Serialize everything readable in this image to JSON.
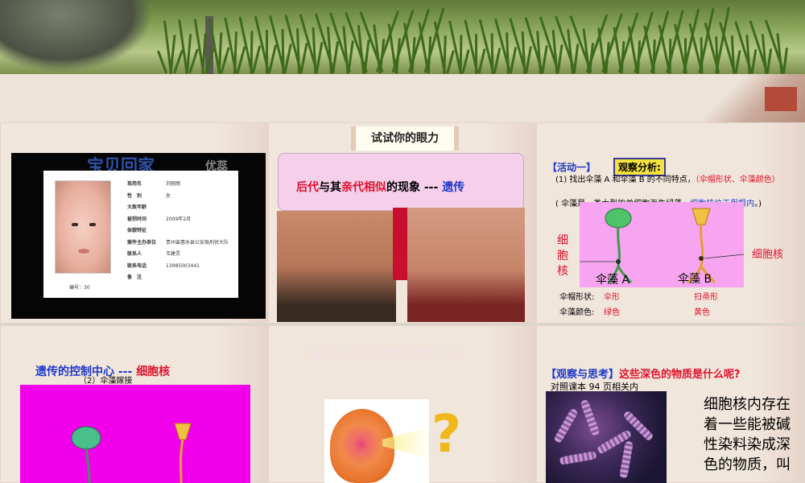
{
  "slide1": {
    "title": "宝贝回家",
    "subtitle": "优蕊",
    "fields": [
      {
        "k": "现用名",
        "v": "刘丽丽"
      },
      {
        "k": "性　别",
        "v": "女"
      },
      {
        "k": "大致年龄",
        "v": ""
      },
      {
        "k": "被拐时间",
        "v": "2009年2月"
      },
      {
        "k": "体貌特征",
        "v": ""
      },
      {
        "k": "案件主办单位",
        "v": "贵州省惠水县公安局刑侦大队"
      },
      {
        "k": "联系人",
        "v": "韦建灵"
      },
      {
        "k": "联系电话",
        "v": "13985003441"
      },
      {
        "k": "备　注",
        "v": ""
      }
    ],
    "card_number": "编号：30"
  },
  "slide2": {
    "scroll_title": "试试你的眼力",
    "banner_a": "后代",
    "banner_b": "与其",
    "banner_c": "亲代相似",
    "banner_d": "的现象 --- ",
    "banner_e": "遗传"
  },
  "slide3": {
    "activity": "【活动一】",
    "observe": "观察分析:",
    "line1_a": "(1) 找出伞藻 A 和伞藻 B 的不同特点，",
    "line1_b": "（伞帽形状、伞藻颜色）",
    "line2_a": "( 伞藻是一类大型的单细胞海生绿藻，",
    "line2_b": "细胞核位于假根内",
    "line2_c": "。)",
    "nucleus_left": "细胞核",
    "nucleus_right": "细胞核",
    "label_a": "伞藻 A",
    "label_b": "伞藻 B",
    "cap_shape_label": "伞帽形状:",
    "cap_shape_a": "伞形",
    "cap_shape_b": "扫帚形",
    "color_label": "伞藻颜色:",
    "color_a": "绿色",
    "color_b": "黄色"
  },
  "slide4": {
    "title_a": "遗传的控制中心 --- ",
    "title_b": "细胞核",
    "subtitle": "（2）伞藻嫁接"
  },
  "slide5": {
    "faint_title": "细胞核是遗传的控制中心",
    "question": "?"
  },
  "slide6": {
    "title_a": "【观察与思考】",
    "title_b": "这些深色的物质是什么呢?",
    "subtitle": "对照课本 94 页相关内",
    "body": "细胞核内存在着一些能被碱性染料染成深色的物质，叫"
  },
  "colors": {
    "blue_text": "#1d38c9",
    "red_text": "#e0102a",
    "magenta": "#f200ec",
    "light_pink": "#f7a5f0",
    "banner_pink": "#f6cfea",
    "yellow_box": "#f7e33e"
  }
}
